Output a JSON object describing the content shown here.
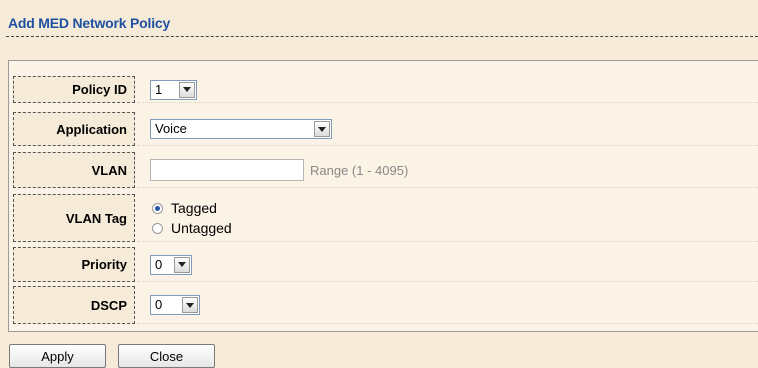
{
  "page": {
    "title": "Add MED Network Policy"
  },
  "form": {
    "policy_id": {
      "label": "Policy ID",
      "value": "1"
    },
    "application": {
      "label": "Application",
      "value": "Voice"
    },
    "vlan": {
      "label": "VLAN",
      "value": "",
      "range": "Range (1 - 4095)"
    },
    "vlan_tag": {
      "label": "VLAN Tag",
      "options": [
        {
          "label": "Tagged",
          "checked": true
        },
        {
          "label": "Untagged",
          "checked": false
        }
      ]
    },
    "priority": {
      "label": "Priority",
      "value": "0"
    },
    "dscp": {
      "label": "DSCP",
      "value": "0"
    }
  },
  "buttons": {
    "apply": "Apply",
    "close": "Close"
  },
  "colors": {
    "title": "#1e51a0",
    "background": "#f6ead8",
    "panel": "#fbf3e6"
  }
}
